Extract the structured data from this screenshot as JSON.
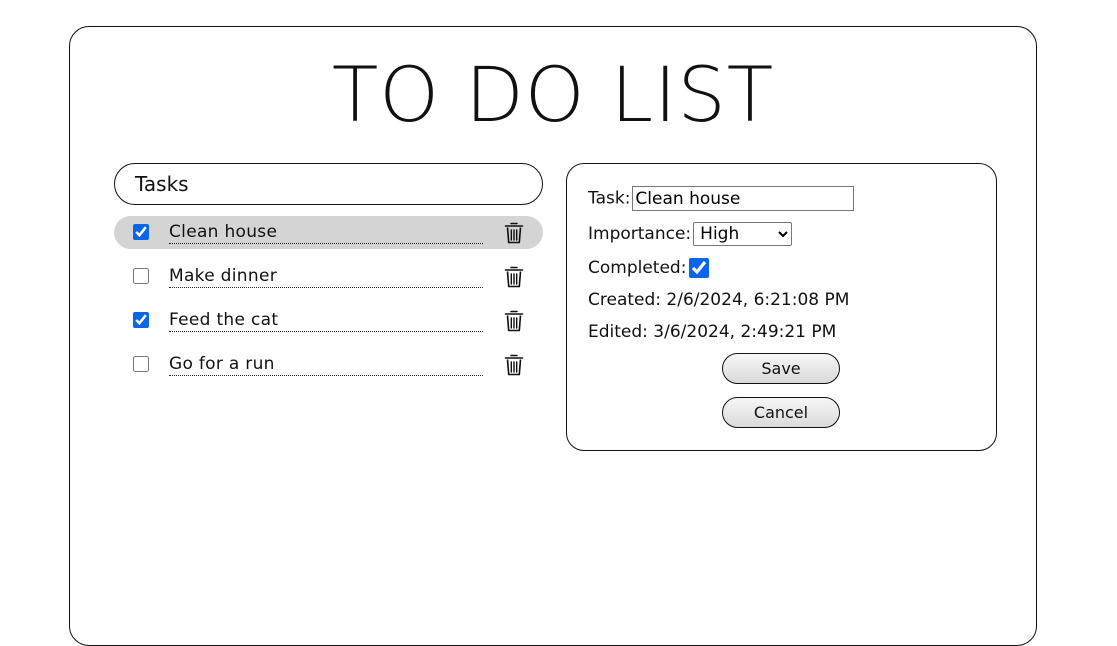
{
  "app": {
    "title": "TO DO LIST"
  },
  "tasks": {
    "header": "Tasks",
    "items": [
      {
        "label": "Clean house",
        "completed": true,
        "selected": true
      },
      {
        "label": "Make dinner",
        "completed": false,
        "selected": false
      },
      {
        "label": "Feed the cat",
        "completed": true,
        "selected": false
      },
      {
        "label": "Go for a run",
        "completed": false,
        "selected": false
      }
    ],
    "delete_icon": "trash-icon"
  },
  "details": {
    "task_label": "Task:",
    "task_value": "Clean house",
    "importance_label": "Importance:",
    "importance_value": "High",
    "completed_label": "Completed:",
    "completed_value": true,
    "created": "Created: 2/6/2024, 6:21:08 PM",
    "edited": "Edited: 3/6/2024, 2:49:21 PM",
    "save_label": "Save",
    "cancel_label": "Cancel"
  },
  "colors": {
    "selected_row": "#d4d4d4",
    "checkbox_accent": "#0a66e8"
  }
}
